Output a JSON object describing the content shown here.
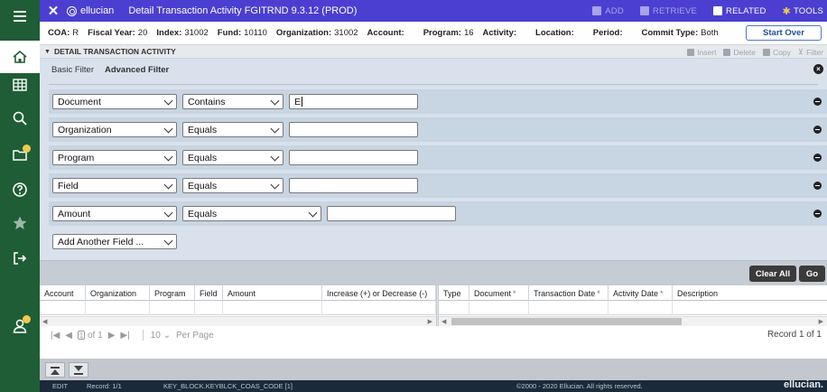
{
  "rail": {
    "items": [
      {
        "name": "menu-icon"
      },
      {
        "name": "home-icon"
      },
      {
        "name": "grid-icon"
      },
      {
        "name": "search-icon"
      },
      {
        "name": "folder-icon"
      },
      {
        "name": "help-icon"
      },
      {
        "name": "star-icon"
      },
      {
        "name": "signout-icon"
      },
      {
        "name": "user-icon"
      }
    ]
  },
  "header": {
    "brand": "ellucian",
    "title": "Detail Transaction Activity FGITRND 9.3.12 (PROD)",
    "actions": {
      "add": "ADD",
      "retrieve": "RETRIEVE",
      "related": "RELATED",
      "tools": "TOOLS"
    }
  },
  "keyblock": {
    "coa_label": "COA:",
    "coa_value": "R",
    "fiscal_label": "Fiscal Year:",
    "fiscal_value": "20",
    "index_label": "Index:",
    "index_value": "31002",
    "fund_label": "Fund:",
    "fund_value": "10110",
    "org_label": "Organization:",
    "org_value": "31002",
    "account_label": "Account:",
    "account_value": "",
    "program_label": "Program:",
    "program_value": "16",
    "activity_label": "Activity:",
    "activity_value": "",
    "location_label": "Location:",
    "location_value": "",
    "period_label": "Period:",
    "period_value": "",
    "commit_label": "Commit Type:",
    "commit_value": "Both",
    "start_over": "Start Over"
  },
  "section": {
    "title": "DETAIL TRANSACTION ACTIVITY",
    "tools": {
      "insert": "Insert",
      "delete": "Delete",
      "copy": "Copy",
      "filter": "Filter"
    }
  },
  "filter": {
    "tabs": {
      "basic": "Basic Filter",
      "advanced": "Advanced Filter"
    },
    "rows": [
      {
        "field": "Document",
        "operator": "Contains",
        "value": "E"
      },
      {
        "field": "Organization",
        "operator": "Equals",
        "value": ""
      },
      {
        "field": "Program",
        "operator": "Equals",
        "value": ""
      },
      {
        "field": "Field",
        "operator": "Equals",
        "value": ""
      },
      {
        "field": "Amount",
        "operator": "Equals",
        "value": ""
      }
    ],
    "add_field": "Add Another Field ...",
    "clear_all": "Clear All",
    "go": "Go"
  },
  "grid": {
    "columns_left": [
      "Account",
      "Organization",
      "Program",
      "Field",
      "Amount",
      "Increase (+) or Decrease (-)"
    ],
    "columns_right": [
      "Type",
      "Document",
      "Transaction Date",
      "Activity Date",
      "Description"
    ],
    "required_mark": "*"
  },
  "pager": {
    "page_text": "of 1",
    "page_value": "1",
    "per_page_value": "10",
    "per_page_label": "Per Page",
    "record_count": "Record 1 of 1"
  },
  "status": {
    "mode": "EDIT",
    "record": "Record: 1/1",
    "field": "KEY_BLOCK.KEYBLCK_COAS_CODE [1]",
    "copyright": "©2000 - 2020 Ellucian. All rights reserved.",
    "logo": "ellucian."
  },
  "colors": {
    "rail": "#1f5d36",
    "header": "#4a3fd0",
    "filter_bg": "#d9e2ec",
    "status_bg": "#1b2a3a"
  }
}
